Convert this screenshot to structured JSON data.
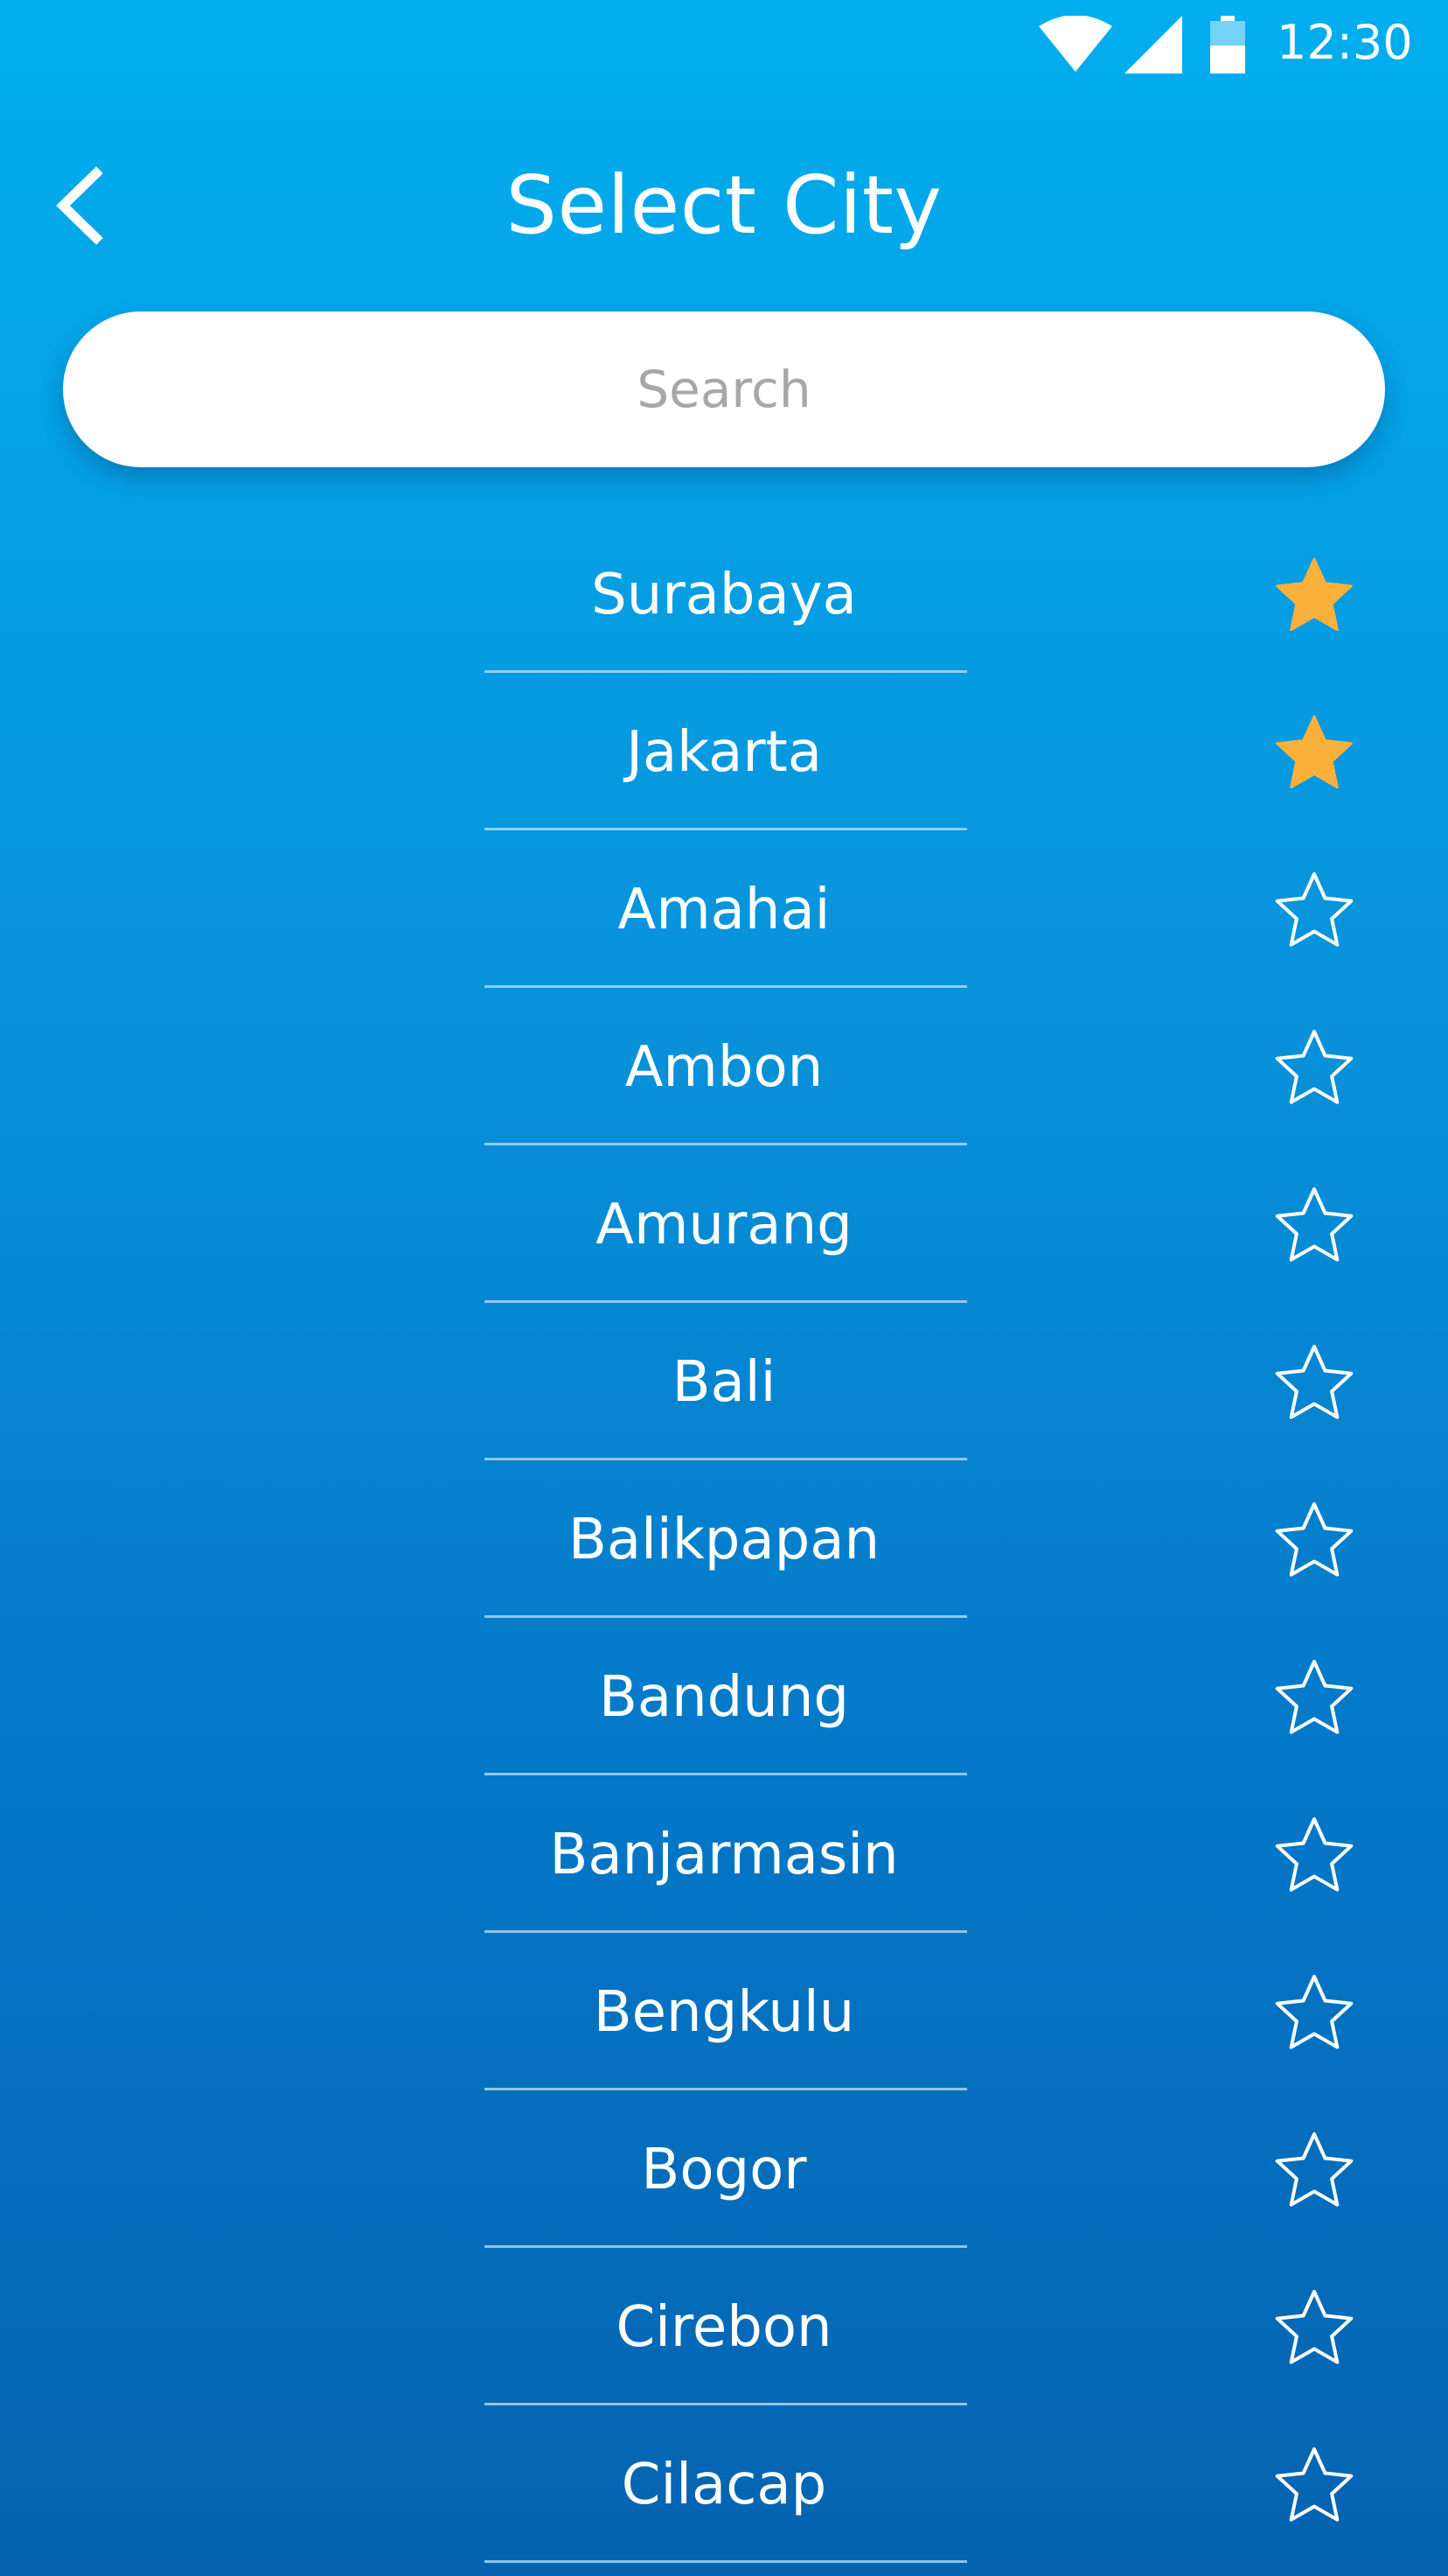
{
  "status_bar": {
    "time": "12:30",
    "icons": [
      "wifi-icon",
      "cellular-signal-icon",
      "battery-icon"
    ]
  },
  "header": {
    "back_icon": "chevron-left-icon",
    "title": "Select City"
  },
  "search": {
    "placeholder": "Search",
    "value": ""
  },
  "colors": {
    "gradient_top": "#01aeee",
    "gradient_bottom": "#0563b0",
    "favorite_star": "#fbb03b",
    "text": "#ffffff",
    "search_placeholder": "#a7a7a7"
  },
  "cities": [
    {
      "name": "Surabaya",
      "favorite": true
    },
    {
      "name": "Jakarta",
      "favorite": true
    },
    {
      "name": "Amahai",
      "favorite": false
    },
    {
      "name": "Ambon",
      "favorite": false
    },
    {
      "name": "Amurang",
      "favorite": false
    },
    {
      "name": "Bali",
      "favorite": false
    },
    {
      "name": "Balikpapan",
      "favorite": false
    },
    {
      "name": "Bandung",
      "favorite": false
    },
    {
      "name": "Banjarmasin",
      "favorite": false
    },
    {
      "name": "Bengkulu",
      "favorite": false
    },
    {
      "name": "Bogor",
      "favorite": false
    },
    {
      "name": "Cirebon",
      "favorite": false
    },
    {
      "name": "Cilacap",
      "favorite": false
    }
  ]
}
